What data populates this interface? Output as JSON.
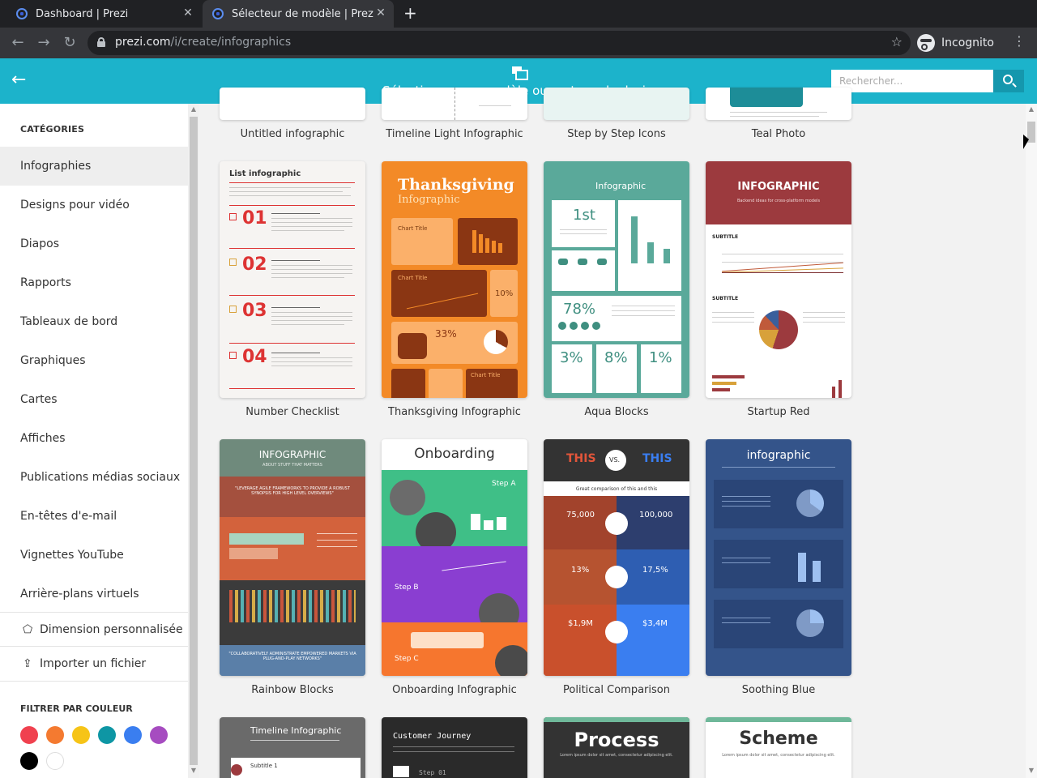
{
  "browser": {
    "tabs": [
      {
        "title": "Dashboard | Prezi"
      },
      {
        "title": "Sélecteur de modèle | Prez"
      }
    ],
    "url_host": "prezi.com",
    "url_path": "/i/create/infographics",
    "incognito_label": "Incognito"
  },
  "header": {
    "title": "Sélectionnez un modèle ou un type de design",
    "search_placeholder": "Rechercher..."
  },
  "sidebar": {
    "categories_heading": "CATÉGORIES",
    "items": [
      {
        "label": "Infographies"
      },
      {
        "label": "Designs pour vidéo"
      },
      {
        "label": "Diapos"
      },
      {
        "label": "Rapports"
      },
      {
        "label": "Tableaux de bord"
      },
      {
        "label": "Graphiques"
      },
      {
        "label": "Cartes"
      },
      {
        "label": "Affiches"
      },
      {
        "label": "Publications médias sociaux"
      },
      {
        "label": "En-têtes d'e-mail"
      },
      {
        "label": "Vignettes YouTube"
      },
      {
        "label": "Arrière-plans virtuels"
      }
    ],
    "custom_size_label": "Dimension personnalisée",
    "import_label": "Importer un fichier",
    "filter_heading": "FILTRER PAR COULEUR",
    "colors": [
      "#f0414f",
      "#f47a30",
      "#f6c417",
      "#0e96a4",
      "#3a7ef0",
      "#a64cc0",
      "#000000",
      "#ffffff"
    ]
  },
  "templates": {
    "row0": [
      {
        "label": "Untitled infographic"
      },
      {
        "label": "Timeline Light Infographic"
      },
      {
        "label": "Step by Step Icons"
      },
      {
        "label": "Teal Photo"
      }
    ],
    "row1": [
      {
        "label": "Number Checklist"
      },
      {
        "label": "Thanksgiving Infographic"
      },
      {
        "label": "Aqua Blocks"
      },
      {
        "label": "Startup Red"
      }
    ],
    "row2": [
      {
        "label": "Rainbow Blocks"
      },
      {
        "label": "Onboarding Infographic"
      },
      {
        "label": "Political Comparison"
      },
      {
        "label": "Soothing Blue"
      }
    ]
  },
  "thumbs": {
    "checklist": {
      "title": "List infographic",
      "n1": "01",
      "n2": "02",
      "n3": "03",
      "n4": "04"
    },
    "thanksgiving": {
      "title": "Thanksgiving",
      "subtitle": "Infographic",
      "chart1": "Chart Title",
      "chart2": "Chart Title",
      "chart3": "Chart Title",
      "pct1": "33%",
      "pct2": "10%"
    },
    "aqua": {
      "title": "Infographic",
      "first": "1st",
      "p78": "78%",
      "p3": "3%",
      "p8": "8%",
      "p1": "1%"
    },
    "startup": {
      "title": "INFOGRAPHIC",
      "sub": "Backend ideas for cross-platform models",
      "subtitle1": "SUBTITLE",
      "subtitle2": "SUBTITLE"
    },
    "rainbow": {
      "title": "INFOGRAPHIC",
      "sub": "ABOUT STUFF THAT MATTERS",
      "quote1": "\"LEVERAGE AGILE FRAMEWORKS TO PROVIDE A ROBUST SYNOPSIS FOR HIGH LEVEL OVERVIEWS\"",
      "quote2": "\"COLLABORATIVELY ADMINISTRATE EMPOWERED MARKETS VIA PLUG-AND-PLAY NETWORKS\""
    },
    "onboarding": {
      "title": "Onboarding",
      "stepA": "Step A",
      "stepB": "Step B",
      "stepC": "Step C"
    },
    "political": {
      "this1": "THIS",
      "vs": "VS.",
      "this2": "THIS",
      "sub": "Great comparison of this and this",
      "v1": "75,000",
      "v2": "100,000",
      "v3": "13%",
      "v4": "17,5%",
      "v5": "$1,9M",
      "v6": "$3,4M"
    },
    "soothing": {
      "title": "infographic"
    },
    "timeline2": {
      "title": "Timeline Infographic",
      "sub": "Subtitle 1"
    },
    "journey": {
      "title": "Customer Journey",
      "step": "Step 01"
    },
    "process": {
      "title": "Process",
      "sub": "Lorem ipsum dolor sit amet, consectetur adipiscing elit."
    },
    "scheme": {
      "title": "Scheme",
      "sub": "Lorem ipsum dolor sit amet, consectetur adipiscing elit."
    }
  }
}
